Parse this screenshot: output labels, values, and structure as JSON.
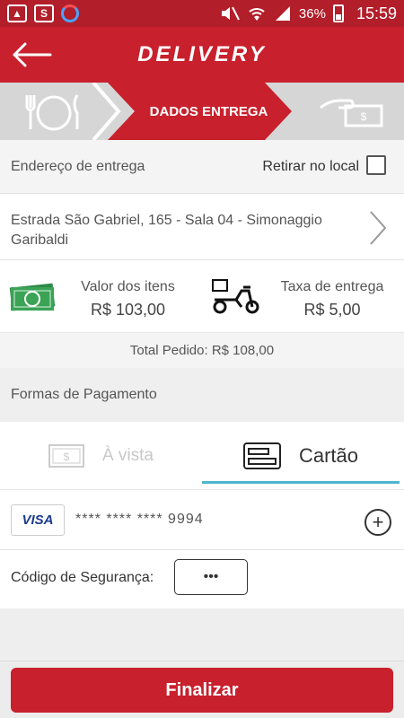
{
  "status_bar": {
    "battery": "36%",
    "time": "15:59",
    "icons": [
      "image-icon",
      "shield-app-icon",
      "sync-ring-icon",
      "mute-icon",
      "wifi-icon",
      "signal-icon",
      "battery-icon"
    ]
  },
  "app_bar": {
    "title": "DELIVERY",
    "back_icon": "arrow-left-icon"
  },
  "stepper": {
    "active_step": "DADOS ENTREGA",
    "steps": [
      "dish-icon",
      "DADOS ENTREGA",
      "payment-hand-icon"
    ]
  },
  "address": {
    "label": "Endereço de entrega",
    "pickup_label": "Retirar no local",
    "pickup_checked": false,
    "value": "Estrada São Gabriel, 165 - Sala 04 - Simonaggio Garibaldi"
  },
  "totals": {
    "items_label": "Valor dos itens",
    "items_value": "R$ 103,00",
    "fee_label": "Taxa de entrega",
    "fee_value": "R$ 5,00",
    "total_label": "Total Pedido:",
    "total_value": "R$ 108,00"
  },
  "payment": {
    "section_title": "Formas de Pagamento",
    "tabs": [
      {
        "label": "À vista",
        "active": false
      },
      {
        "label": "Cartão",
        "active": true
      }
    ],
    "card_brand": "VISA",
    "card_number": "**** **** **** 9994",
    "security_label": "Código de Segurança:",
    "security_value": "•••"
  },
  "footer": {
    "button_label": "Finalizar"
  },
  "colors": {
    "primary": "#c8202d",
    "status_bar": "#b21e2a",
    "tab_accent": "#4db6ce",
    "money_green": "#3aa356"
  }
}
